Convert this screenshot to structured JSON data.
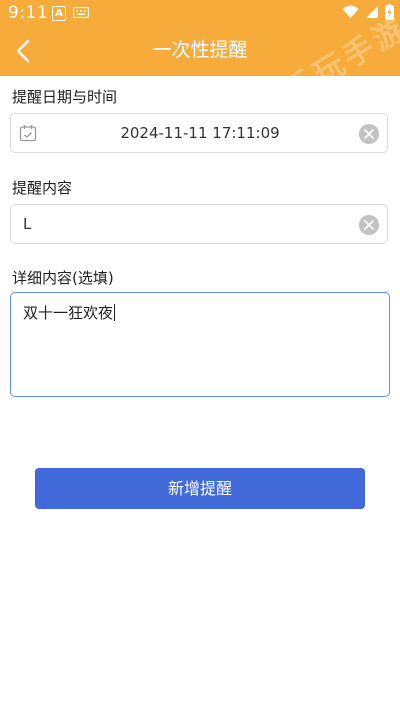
{
  "status_bar": {
    "time": "9:11",
    "icons": [
      "accessibility-a-icon",
      "keyboard-icon",
      "wifi-icon",
      "signal-icon",
      "battery-charging-icon"
    ]
  },
  "header": {
    "title": "一次性提醒",
    "back_icon": "chevron-left-icon",
    "watermark": "乐玩手游",
    "background_color": "#f6ab3b"
  },
  "form": {
    "datetime_label": "提醒日期与时间",
    "datetime_value": "2024-11-11 17:11:09",
    "content_label": "提醒内容",
    "content_value": "L",
    "detail_label": "详细内容(选填)",
    "detail_value": "双十一狂欢夜"
  },
  "submit_label": "新增提醒",
  "colors": {
    "accent": "#4169d9",
    "focus_border": "#5c93f2"
  }
}
